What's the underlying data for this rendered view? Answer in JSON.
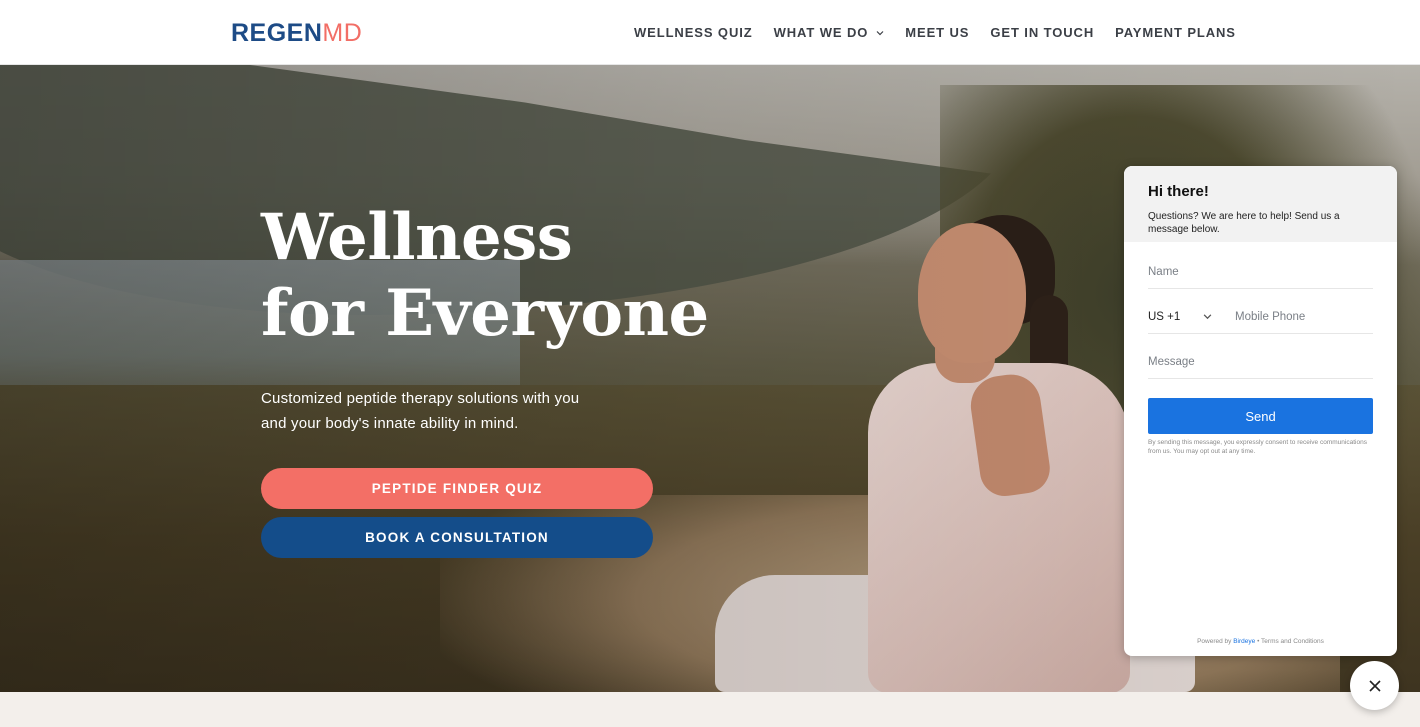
{
  "header": {
    "logo_primary": "REGEN",
    "logo_secondary": "MD",
    "nav": [
      {
        "label": "WELLNESS QUIZ"
      },
      {
        "label": "WHAT WE DO"
      },
      {
        "label": "MEET US"
      },
      {
        "label": "GET IN TOUCH"
      },
      {
        "label": "PAYMENT PLANS"
      }
    ]
  },
  "hero": {
    "title_line1": "Wellness",
    "title_line2": "for Everyone",
    "subtitle": "Customized peptide therapy solutions with you and your body's innate ability in mind.",
    "quiz_button": "PEPTIDE FINDER QUIZ",
    "consult_button": "BOOK A CONSULTATION"
  },
  "chat": {
    "title": "Hi there!",
    "description": "Questions? We are here to help! Send us a message below.",
    "name_placeholder": "Name",
    "country_code": "US +1",
    "phone_placeholder": "Mobile Phone",
    "message_placeholder": "Message",
    "send_label": "Send",
    "consent": "By sending this message, you expressly consent to receive communications from us. You may opt out at any time.",
    "powered_prefix": "Powered by",
    "powered_brand": "Birdeye",
    "powered_suffix": "• Terms and Conditions"
  },
  "colors": {
    "brand_blue": "#144d8a",
    "brand_coral": "#f36f66",
    "send_blue": "#1a73e0"
  }
}
